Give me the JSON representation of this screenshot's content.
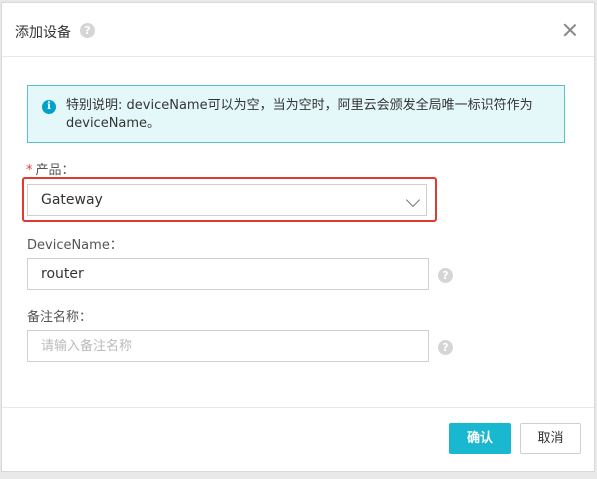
{
  "dialog": {
    "title": "添加设备",
    "title_help": "?",
    "notice": {
      "icon": "i",
      "text": "特别说明: deviceName可以为空，当为空时，阿里云会颁发全局唯一标识符作为deviceName。"
    },
    "product": {
      "required_mark": "*",
      "label": "产品：",
      "value": "Gateway"
    },
    "device_name": {
      "label": "DeviceName：",
      "value": "router",
      "help": "?"
    },
    "remark": {
      "label": "备注名称：",
      "placeholder": "请输入备注名称",
      "help": "?"
    },
    "buttons": {
      "confirm": "确认",
      "cancel": "取消"
    }
  },
  "colors": {
    "primary": "#1ab8d0",
    "notice_bg": "#e4f8f9",
    "notice_border": "#56c2c8",
    "highlight": "#e03a2e"
  }
}
